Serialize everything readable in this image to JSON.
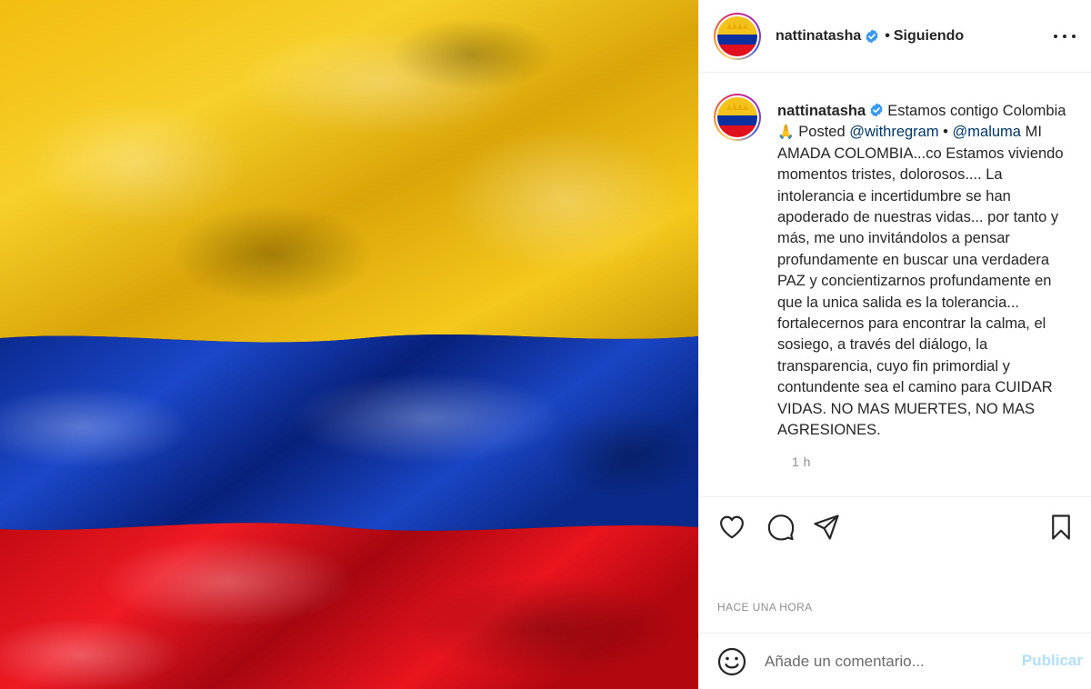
{
  "post": {
    "username": "nattinatasha",
    "follow_status": "Siguiendo",
    "dot": "•"
  },
  "caption": {
    "username": "nattinatasha",
    "part1": "Estamos contigo Colombia ",
    "emoji": "🙏",
    "part2": " Posted ",
    "mention1": "@withregram",
    "part3": " • ",
    "mention2": "@maluma",
    "part4": " MI AMADA COLOMBIA...co Estamos viviendo momentos tristes, dolorosos.... La intolerancia e incertidumbre se han apoderado de nuestras vidas... por tanto y más, me uno invitándolos a pensar profundamente en buscar una verdadera PAZ y concientizarnos profundamente en que la unica salida es la tolerancia... fortalecernos para encontrar la calma, el sosiego, a través del diálogo, la transparencia, cuyo fin primordial y contundente sea el camino para CUIDAR VIDAS. NO MAS MUERTES, NO MAS AGRESIONES.",
    "time_ago": "1 h"
  },
  "timestamp": "HACE UNA HORA",
  "comment": {
    "placeholder": "Añade un comentario...",
    "publish_label": "Publicar"
  },
  "colors": {
    "flag_yellow": "#f4c21a",
    "flag_blue": "#0a2f9e",
    "flag_red": "#e0101c",
    "verified_blue": "#3897f0",
    "publish_disabled": "#b2dffc"
  },
  "icons": {
    "like": "heart-icon",
    "comment": "comment-bubble-icon",
    "share": "paper-plane-icon",
    "save": "bookmark-icon",
    "emoji": "smiley-icon",
    "more": "more-dots-icon",
    "verified": "verified-badge-icon"
  }
}
